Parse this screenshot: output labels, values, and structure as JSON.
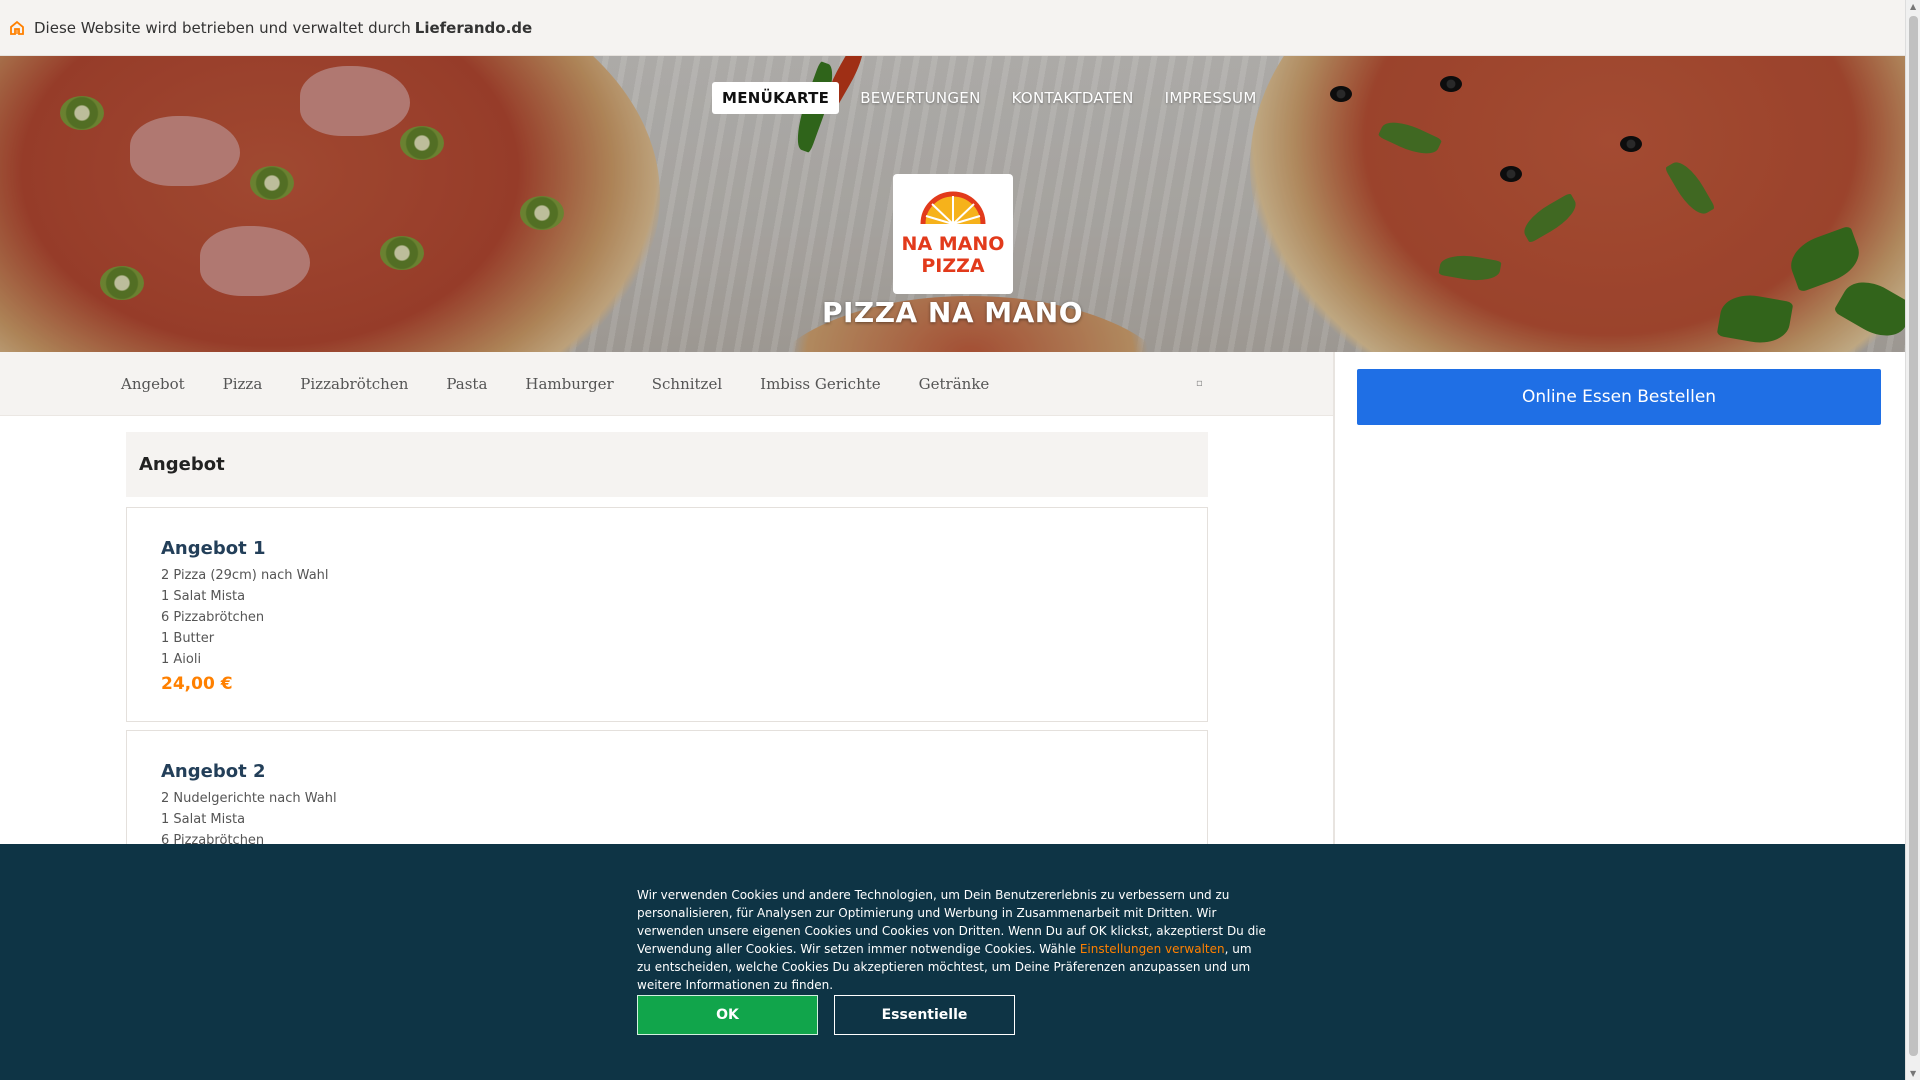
{
  "topbar": {
    "text": "Diese Website wird betrieben und verwaltet durch",
    "brand": "Lieferando.de"
  },
  "nav": {
    "items": [
      "MENÜKARTE",
      "BEWERTUNGEN",
      "KONTAKTDATEN",
      "IMPRESSUM"
    ]
  },
  "logo": {
    "line1": "NA MANO",
    "line2": "PIZZA"
  },
  "restaurant": {
    "name": "PIZZA NA MANO"
  },
  "categories": [
    "Angebot",
    "Pizza",
    "Pizzabrötchen",
    "Pasta",
    "Hamburger",
    "Schnitzel",
    "Imbiss Gerichte",
    "Getränke"
  ],
  "order_button": "Online Essen Bestellen",
  "section": {
    "title": "Angebot"
  },
  "cards": [
    {
      "title": "Angebot 1",
      "lines": [
        "2 Pizza (29cm) nach Wahl",
        "1 Salat Mista",
        "6 Pizzabrötchen",
        "1 Butter",
        "1 Aioli"
      ],
      "price": "24,00 €"
    },
    {
      "title": "Angebot 2",
      "lines": [
        "2 Nudelgerichte nach Wahl",
        "1 Salat Mista",
        "6 Pizzabrötchen"
      ]
    }
  ],
  "cookie": {
    "text_before": "Wir verwenden Cookies und andere Technologien, um Dein Benutzererlebnis zu verbessern und zu personalisieren, für Analysen zur Optimierung und Werbung in Zusammenarbeit mit Dritten. Wir verwenden unsere eigenen Cookies und Cookies von Dritten. Wenn Du auf OK klickst, akzeptierst Du die Verwendung aller Cookies. Wir setzen immer notwendige Cookies. Wähle",
    "link": "Einstellungen verwalten",
    "text_after": ", um zu entscheiden, welche Cookies Du akzeptieren möchtest, um Deine Präferenzen anzupassen und um weitere Informationen zu finden.",
    "ok": "OK",
    "essential": "Essentielle"
  },
  "colors": {
    "accent": "#ff8000",
    "order_button": "#1f6fe5",
    "cookie_bg": "#0e3445",
    "ok_button": "#11a54b"
  }
}
